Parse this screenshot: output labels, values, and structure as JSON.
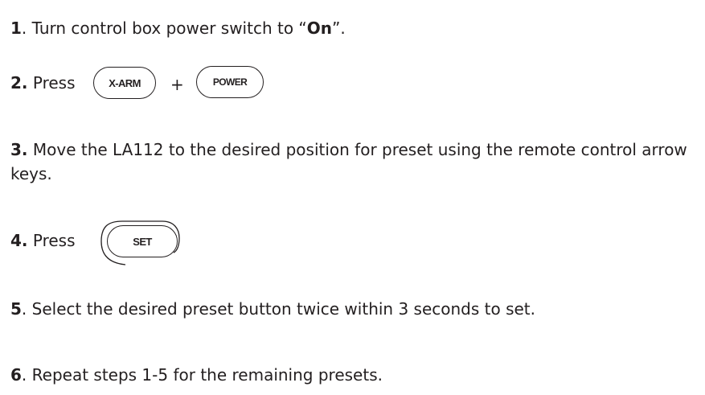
{
  "steps": [
    {
      "number": "1",
      "sep": ". ",
      "text": "Turn control box power switch to “",
      "emphasis": "On",
      "text_after": "”."
    },
    {
      "number": "2.",
      "text": "Press",
      "keys": [
        "X-ARM",
        "POWER"
      ],
      "plus": "+"
    },
    {
      "number": "3.",
      "text": "Move the LA112 to the desired position for preset using the remote control arrow keys."
    },
    {
      "number": "4.",
      "text": "Press",
      "keys": [
        "SET"
      ]
    },
    {
      "number": "5",
      "text": ". Select the desired preset button twice within 3 seconds to set."
    },
    {
      "number": "6",
      "text": ". Repeat steps 1-5 for the remaining presets."
    }
  ]
}
